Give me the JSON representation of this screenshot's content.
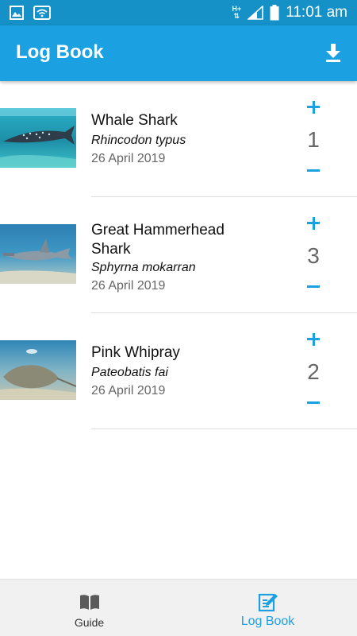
{
  "status_bar": {
    "time": "11:01 am",
    "network": "H+",
    "icons": [
      "image-icon",
      "wifi-icon",
      "network-arrows-icon",
      "signal-icon",
      "battery-icon"
    ]
  },
  "app_bar": {
    "title": "Log Book",
    "download_icon": "download-icon"
  },
  "colors": {
    "accent": "#1ba1e2",
    "status_bar": "#1591c7",
    "secondary_text": "#666666"
  },
  "entries": [
    {
      "name": "Whale Shark",
      "scientific_name": "Rhincodon typus",
      "date": "26 April 2019",
      "count": "1",
      "image": "whale-shark-photo"
    },
    {
      "name": "Great Hammerhead Shark",
      "scientific_name": "Sphyrna mokarran",
      "date": "26 April 2019",
      "count": "3",
      "image": "hammerhead-shark-photo"
    },
    {
      "name": "Pink Whipray",
      "scientific_name": "Pateobatis fai",
      "date": "26 April 2019",
      "count": "2",
      "image": "pink-whipray-photo"
    }
  ],
  "bottom_nav": {
    "items": [
      {
        "label": "Guide",
        "icon": "book-icon",
        "active": false
      },
      {
        "label": "Log Book",
        "icon": "edit-note-icon",
        "active": true
      }
    ]
  }
}
